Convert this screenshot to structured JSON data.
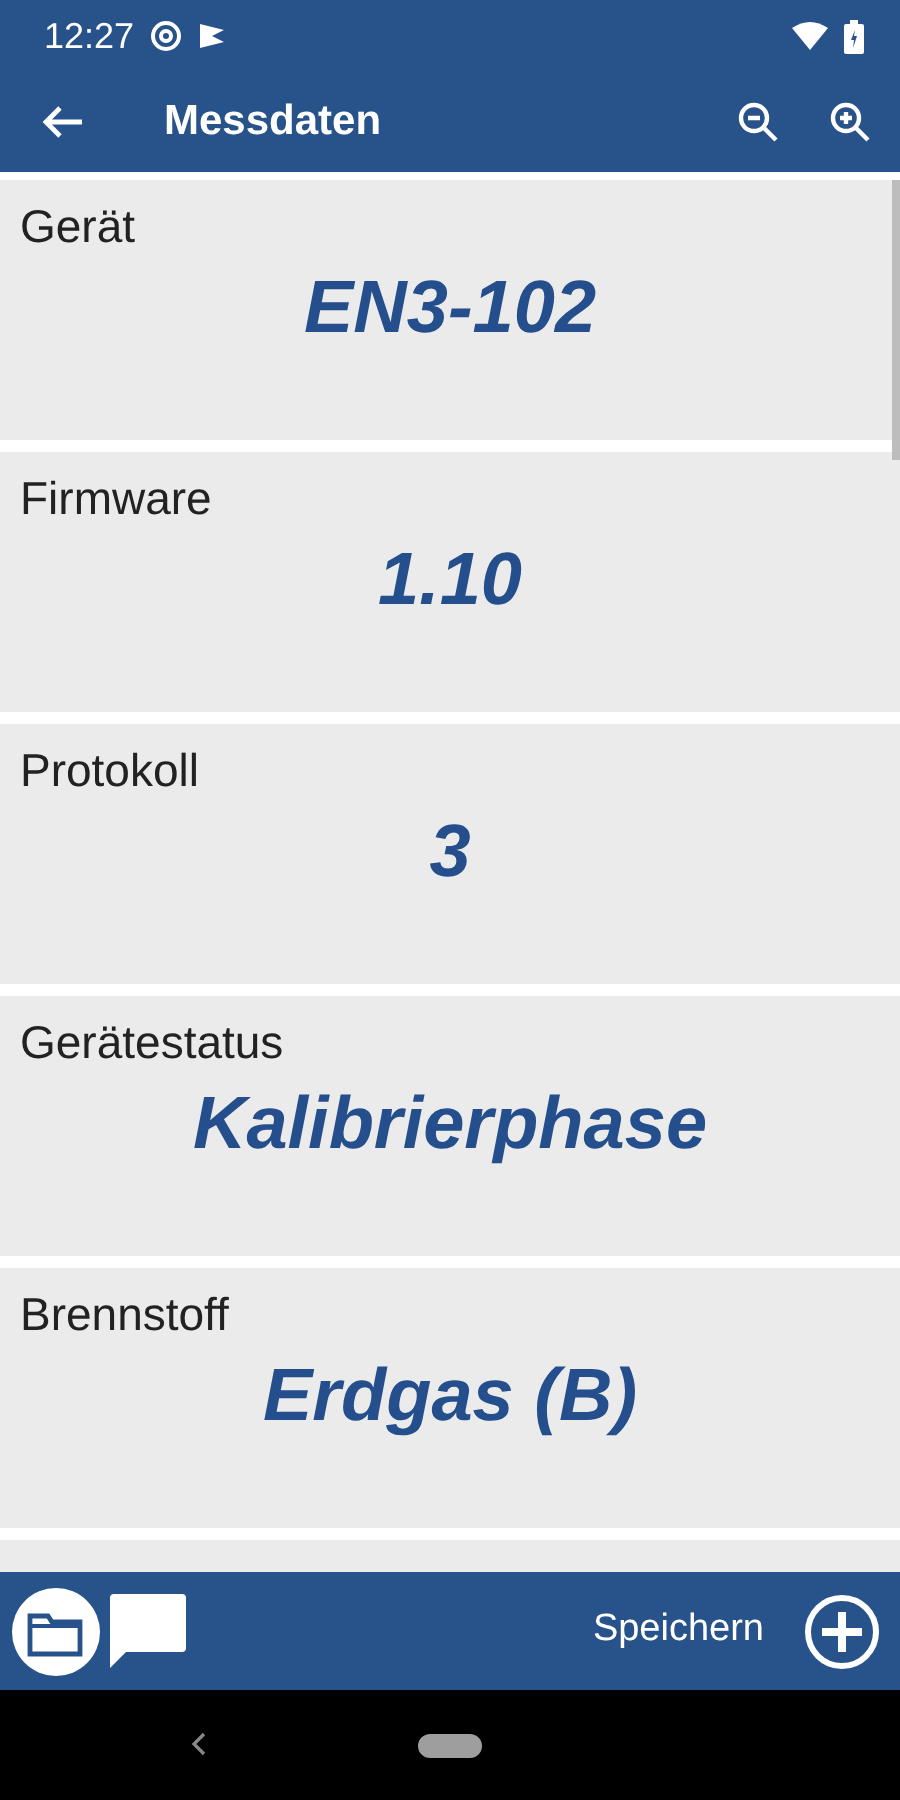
{
  "status_bar": {
    "time": "12:27"
  },
  "app_bar": {
    "title": "Messdaten"
  },
  "fields": [
    {
      "label": "Gerät",
      "value": "EN3-102"
    },
    {
      "label": "Firmware",
      "value": "1.10"
    },
    {
      "label": "Protokoll",
      "value": "3"
    },
    {
      "label": "Gerätestatus",
      "value": "Kalibrierphase"
    },
    {
      "label": "Brennstoff",
      "value": "Erdgas (B)"
    }
  ],
  "bottom_bar": {
    "save_label": "Speichern"
  }
}
